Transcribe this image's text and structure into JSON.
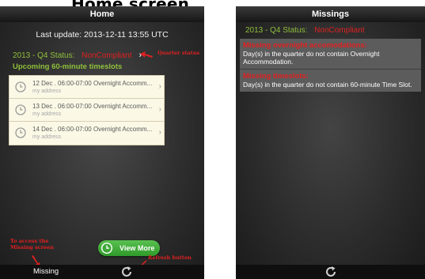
{
  "caption": "Home screen",
  "left_screen": {
    "title": "Home",
    "last_update": "Last update: 2013-12-11 13:55 UTC",
    "status_prefix": "2013 - Q4 Status:",
    "status_value": "NonCompliant",
    "upcoming_heading": "Upcoming 60-minute timeslots",
    "slots": [
      {
        "title": "12 Dec . 06:00-07:00 Overnight Accomm...",
        "subtitle": "my address"
      },
      {
        "title": "13 Dec . 06:00-07:00 Overnight Accomm...",
        "subtitle": "my address"
      },
      {
        "title": "14 Dec . 06:00-07:00 Overnight Accomm...",
        "subtitle": "my address"
      }
    ],
    "view_more_label": "View More",
    "bottom_tab_label": "Missing",
    "annotations": {
      "quarter_status": "Quarter status",
      "missing_screen": "To access the Missing screen",
      "refresh_button": "Refresh button"
    }
  },
  "right_screen": {
    "title": "Missings",
    "status_prefix": "2013 - Q4 Status:",
    "status_value": "NonCompliant",
    "missing_items": [
      {
        "title": "Missing overnight accomodations:",
        "text": "Day(s) in the quarter do not contain Overnight Accommodation."
      },
      {
        "title": "Missing timeslots:",
        "text": "Day(s) in the quarter do not contain 60-minute Time Slot."
      }
    ]
  },
  "colors": {
    "accent_green": "#8fbf3a",
    "alert_red": "#e02020",
    "slot_bg": "#fbf8e6",
    "button_green": "#3fa83a"
  }
}
